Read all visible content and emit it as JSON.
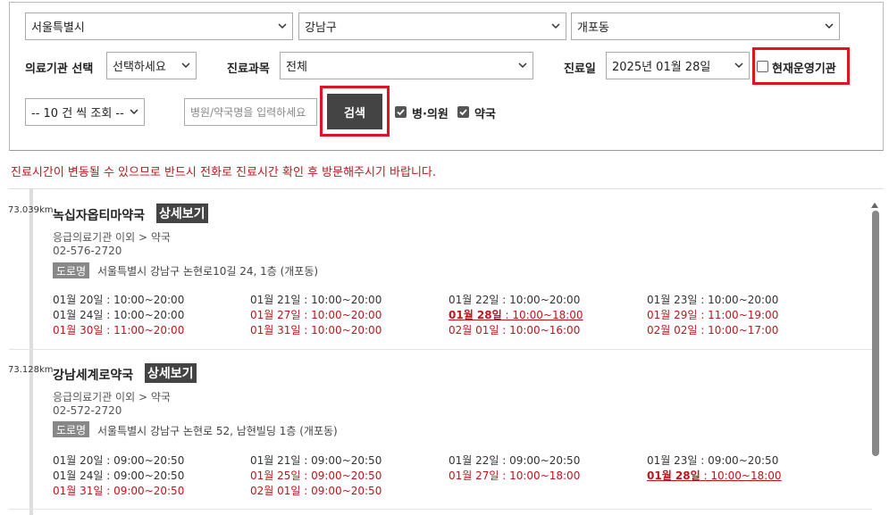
{
  "filters": {
    "city": "서울특별시",
    "district": "강남구",
    "neighborhood": "개포동",
    "institution_label": "의료기관 선택",
    "institution_value": "선택하세요",
    "department_label": "진료과목",
    "department_value": "전체",
    "date_label": "진료일",
    "date_value": "2025년 01월 28일",
    "open_now_label": "현재운영기관",
    "page_size": "-- 10 건 씩 조회 --",
    "search_placeholder": "병원/약국명을 입력하세요",
    "search_button": "검색",
    "hospital_label": "병·의원",
    "pharmacy_label": "약국"
  },
  "notice": "진료시간이 변동될 수 있으므로 반드시 전화로 진료시간 확인 후 방문해주시기 바랍니다.",
  "detail_label": "상세보기",
  "road_label": "도로명",
  "results": [
    {
      "distance": "73.039km",
      "name": "녹십자옵티마약국",
      "category": "응급의료기관 이외 > 약국",
      "phone": "02-576-2720",
      "address": "서울특별시 강남구 논현로10길 24, 1층 (개포동)",
      "schedule": [
        {
          "day": "01월 20일",
          "time": " : 10:00~20:00",
          "style": "normal"
        },
        {
          "day": "01월 21일",
          "time": " : 10:00~20:00",
          "style": "normal"
        },
        {
          "day": "01월 22일",
          "time": " : 10:00~20:00",
          "style": "normal"
        },
        {
          "day": "01월 23일",
          "time": " : 10:00~20:00",
          "style": "normal"
        },
        {
          "day": "01월 24일",
          "time": " : 10:00~20:00",
          "style": "normal"
        },
        {
          "day": "01월 27일",
          "time": " : 10:00~20:00",
          "style": "red"
        },
        {
          "day": "01월 28일",
          "time": " : 10:00~18:00",
          "style": "today"
        },
        {
          "day": "01월 29일",
          "time": " : 11:00~19:00",
          "style": "red"
        },
        {
          "day": "01월 30일",
          "time": " : 11:00~20:00",
          "style": "red"
        },
        {
          "day": "01월 31일",
          "time": " : 10:00~20:00",
          "style": "red"
        },
        {
          "day": "02월 01일",
          "time": " : 10:00~16:00",
          "style": "red"
        },
        {
          "day": "02월 02일",
          "time": " : 10:00~17:00",
          "style": "red"
        }
      ]
    },
    {
      "distance": "73.128km",
      "name": "강남세계로약국",
      "category": "응급의료기관 이외 > 약국",
      "phone": "02-572-2720",
      "address": "서울특별시 강남구 논현로 52, 남현빌딩 1층 (개포동)",
      "schedule": [
        {
          "day": "01월 20일",
          "time": " : 09:00~20:50",
          "style": "normal"
        },
        {
          "day": "01월 21일",
          "time": " : 09:00~20:50",
          "style": "normal"
        },
        {
          "day": "01월 22일",
          "time": " : 09:00~20:50",
          "style": "normal"
        },
        {
          "day": "01월 23일",
          "time": " : 09:00~20:50",
          "style": "normal"
        },
        {
          "day": "01월 24일",
          "time": " : 09:00~20:50",
          "style": "normal"
        },
        {
          "day": "01월 25일",
          "time": " : 09:00~20:50",
          "style": "red"
        },
        {
          "day": "01월 27일",
          "time": " : 10:00~18:00",
          "style": "red"
        },
        {
          "day": "01월 28일",
          "time": " : 10:00~18:00",
          "style": "today"
        },
        {
          "day": "01월 31일",
          "time": " : 09:00~20:50",
          "style": "red"
        },
        {
          "day": "02월 01일",
          "time": " : 09:00~20:50",
          "style": "red"
        }
      ]
    }
  ],
  "colors": {
    "accent_red": "#e0141e",
    "dark_button": "#444444",
    "holiday_red": "#c0141e"
  }
}
